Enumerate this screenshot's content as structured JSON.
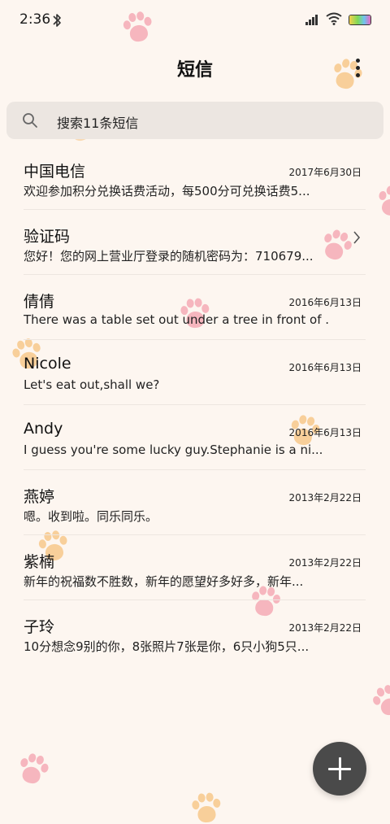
{
  "status_bar": {
    "time": "2:36",
    "icons": [
      "bluetooth-icon",
      "signal-icon",
      "wifi-icon",
      "battery-icon"
    ]
  },
  "header": {
    "title": "短信",
    "more_icon": "more-vertical-icon"
  },
  "search": {
    "placeholder": "搜索11条短信",
    "icon": "search-icon"
  },
  "messages": [
    {
      "sender": "中国电信",
      "date": "2017年6月30日",
      "preview": "欢迎参加积分兑换话费活动，每500分可兑换话费5..."
    },
    {
      "sender": "验证码",
      "date": "",
      "preview": "您好！您的网上营业厅登录的随机密码为：710679...",
      "has_chevron": true
    },
    {
      "sender": "倩倩",
      "date": "2016年6月13日",
      "preview": "There was a table set out under a tree in front of ..."
    },
    {
      "sender": "Nicole",
      "date": "2016年6月13日",
      "preview": "Let's eat out,shall we?"
    },
    {
      "sender": "Andy",
      "date": "2016年6月13日",
      "preview": "I guess you're some lucky guy.Stephanie is a ni..."
    },
    {
      "sender": "燕婷",
      "date": "2013年2月22日",
      "preview": "嗯。收到啦。同乐同乐。"
    },
    {
      "sender": "紫楠",
      "date": "2013年2月22日",
      "preview": "新年的祝福数不胜数，新年的愿望好多好多，新年..."
    },
    {
      "sender": "子玲",
      "date": "2013年2月22日",
      "preview": "10分想念9别的你，8张照片7张是你，6只小狗5只..."
    }
  ],
  "fab": {
    "icon": "plus-icon"
  },
  "colors": {
    "background": "#fdf6f0",
    "search_bg": "#ece6e1",
    "fab_bg": "#4a4a4a",
    "paw_pink": "#f6b6be",
    "paw_orange": "#f8cf9a"
  }
}
